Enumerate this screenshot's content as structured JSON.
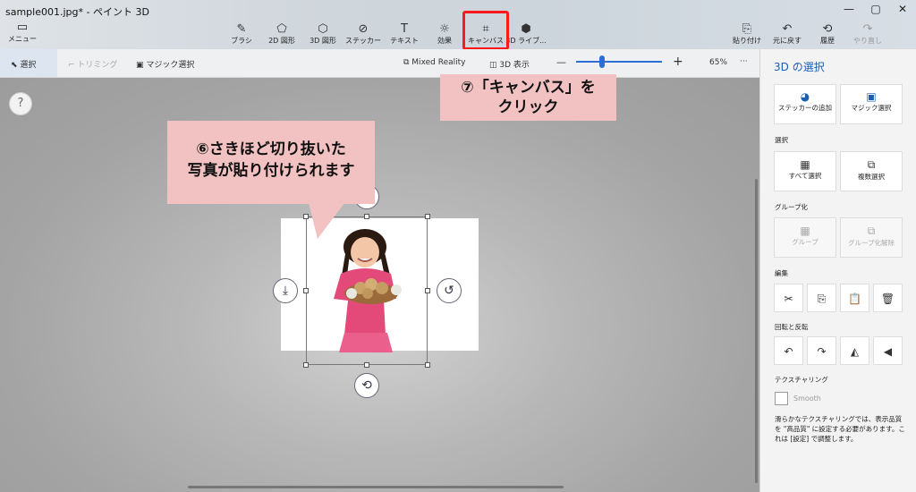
{
  "app": {
    "title": "sample001.jpg* - ペイント 3D",
    "window_controls": [
      "—",
      "▢",
      "✕"
    ]
  },
  "menu": {
    "label": "メニュー"
  },
  "tools": [
    {
      "label": "ブラシ",
      "icon": "✎"
    },
    {
      "label": "2D 図形",
      "icon": "⬠"
    },
    {
      "label": "3D 図形",
      "icon": "⬡"
    },
    {
      "label": "ステッカー",
      "icon": "⊘"
    },
    {
      "label": "テキスト",
      "icon": "T"
    },
    {
      "label": "効果",
      "icon": "☼"
    },
    {
      "label": "キャンバス",
      "icon": "⌗"
    },
    {
      "label": "3D ライブ...",
      "icon": "⬢"
    }
  ],
  "right_tools": [
    {
      "label": "貼り付け",
      "icon": "⎘"
    },
    {
      "label": "元に戻す",
      "icon": "↶"
    },
    {
      "label": "履歴",
      "icon": "⟲"
    },
    {
      "label": "やり直し",
      "icon": "↷"
    }
  ],
  "toolbar2": {
    "select": "選択",
    "trimming": "トリミング",
    "magic_select": "マジック選択",
    "mixed_reality": "Mixed Reality",
    "view3d": "3D 表示",
    "zoom_minus": "—",
    "zoom_plus": "+",
    "zoom": "65%",
    "more": "···"
  },
  "zoom_level": 0.3,
  "help": "?",
  "callouts": {
    "c6_line1": "⑥さきほど切り抜いた",
    "c6_line2": "写真が貼り付けられます",
    "c7_line1": "⑦「キャンバス」を",
    "c7_line2": "クリック"
  },
  "panel": {
    "title": "3D の選択",
    "add_sticker": "ステッカーの追加",
    "magic_select": "マジック選択",
    "section_select": "選択",
    "select_all": "すべて選択",
    "multi_select": "複数選択",
    "section_group": "グループ化",
    "group": "グループ",
    "ungroup": "グループ化解除",
    "section_edit": "編集",
    "section_rotate": "回転と反転",
    "section_texture": "テクスチャリング",
    "smooth": "Smooth",
    "note": "滑らかなテクスチャリングでは、表示品質を \"高品質\" に設定する必要があります。これは [設定] で調整します。"
  },
  "colors": {
    "accent": "#1a5fb4",
    "highlight": "#ff1a1a",
    "callout_bg": "#f2c2c2"
  }
}
